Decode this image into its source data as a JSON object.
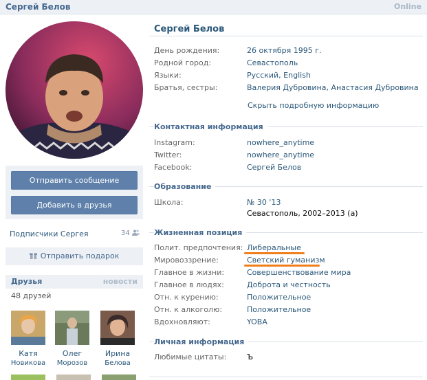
{
  "header": {
    "name": "Сергей Белов",
    "status": "Online"
  },
  "left": {
    "buttons": {
      "message": "Отправить сообщение",
      "add_friend": "Добавить в друзья"
    },
    "subscribers": {
      "label": "Подписчики Сергея",
      "count": "34"
    },
    "gift": "Отправить подарок",
    "friends": {
      "title": "Друзья",
      "news_link": "новости",
      "count": "48 друзей",
      "items": [
        {
          "first": "Катя",
          "last": "Новикова"
        },
        {
          "first": "Олег",
          "last": "Морозов"
        },
        {
          "first": "Ирина",
          "last": "Белова"
        }
      ]
    }
  },
  "profile": {
    "name": "Сергей Белов",
    "basic": [
      {
        "label": "День рождения:",
        "value": "26 октября 1995 г."
      },
      {
        "label": "Родной город:",
        "value": "Севастополь"
      },
      {
        "label": "Языки:",
        "value": "Русский, English"
      },
      {
        "label": "Братья, сестры:",
        "value": "Валерия Дубровина, Анастасия Дубровина"
      }
    ],
    "hide_details": "Скрыть подробную информацию",
    "contacts": {
      "title": "Контактная информация",
      "rows": [
        {
          "label": "Instagram:",
          "value": "nowhere_anytime"
        },
        {
          "label": "Twitter:",
          "value": "nowhere_anytime"
        },
        {
          "label": "Facebook:",
          "value": "Сергей Белов"
        }
      ]
    },
    "education": {
      "title": "Образование",
      "label": "Школа:",
      "school": "№ 30 '13",
      "details": "Севастополь, 2002–2013 (а)"
    },
    "position": {
      "title": "Жизненная позиция",
      "rows": [
        {
          "label": "Полит. предпочтения:",
          "value": "Либеральные"
        },
        {
          "label": "Мировоззрение:",
          "value": "Светский гуманизм"
        },
        {
          "label": "Главное в жизни:",
          "value": "Совершенствование мира"
        },
        {
          "label": "Главное в людях:",
          "value": "Доброта и честность"
        },
        {
          "label": "Отн. к курению:",
          "value": "Положительное"
        },
        {
          "label": "Отн. к алкоголю:",
          "value": "Положительное"
        },
        {
          "label": "Вдохновляют:",
          "value": "YOBA"
        }
      ]
    },
    "personal": {
      "title": "Личная информация",
      "label": "Любимые цитаты:",
      "value": "Ъ"
    }
  },
  "colors": {
    "link": "#2b587a",
    "button": "#5e80aa",
    "highlight": "#f07e1b"
  }
}
